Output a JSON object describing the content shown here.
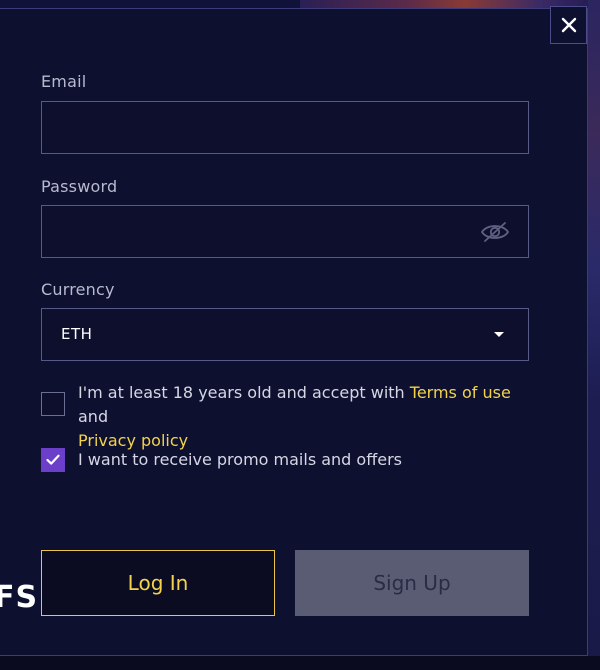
{
  "modal": {
    "close_icon": "close-icon",
    "email": {
      "label": "Email",
      "value": "",
      "placeholder": ""
    },
    "password": {
      "label": "Password",
      "value": "",
      "placeholder": "",
      "toggle_icon": "eye-slash-icon"
    },
    "currency": {
      "label": "Currency",
      "selected": "ETH",
      "caret_icon": "caret-down-icon"
    },
    "age_consent": {
      "checked": false,
      "text_before": "I'm at least 18 years old and accept with ",
      "terms_link": "Terms of use",
      "text_middle": " and",
      "privacy_link": "Privacy policy"
    },
    "promo_consent": {
      "checked": true,
      "text": "I want to receive promo mails and offers"
    },
    "login_button": "Log In",
    "signup_button": "Sign Up"
  },
  "background": {
    "partial_text": "FS"
  },
  "colors": {
    "modal_bg": "#0e1030",
    "accent_yellow": "#f2d34b",
    "checkbox_purple": "#6b3fc9",
    "signup_disabled": "#5a5c74"
  }
}
